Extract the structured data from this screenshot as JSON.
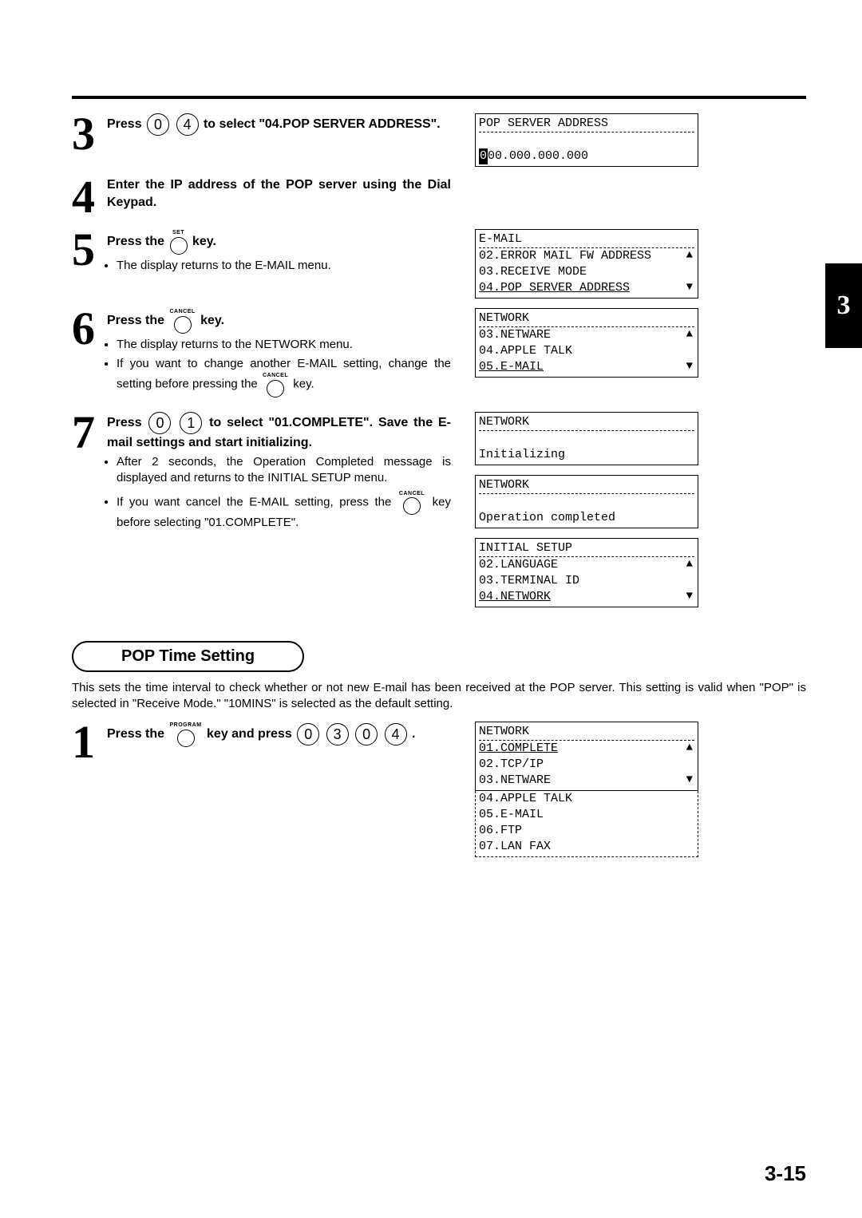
{
  "chapter_tab": "3",
  "page_number": "3-15",
  "key_labels": {
    "set": "SET",
    "cancel": "CANCEL",
    "program": "PROGRAM"
  },
  "keys": {
    "zero": "0",
    "one": "1",
    "three": "3",
    "four": "4"
  },
  "steps": [
    {
      "num": "3",
      "bold_a": "Press",
      "bold_b": "to select \"04.POP SERVER ADDRESS\"."
    },
    {
      "num": "4",
      "bold": "Enter the IP address of the POP server using the Dial Keypad."
    },
    {
      "num": "5",
      "bold_a": "Press the",
      "bold_b": "key.",
      "bullet1": "The display returns to the E-MAIL menu."
    },
    {
      "num": "6",
      "bold_a": "Press the",
      "bold_b": "key.",
      "bullet1": "The display returns to the NETWORK menu.",
      "bullet2_a": "If you want to change another E-MAIL setting, change the setting before pressing the",
      "bullet2_b": "key."
    },
    {
      "num": "7",
      "bold_a": "Press",
      "bold_b": "to select \"01.COMPLETE\". Save the E-mail settings and start initializing.",
      "bullet1": "After 2 seconds, the Operation Completed message is displayed and returns to the INITIAL SETUP menu.",
      "bullet2_a": "If you want cancel the E-MAIL setting, press the",
      "bullet2_b": "key before selecting \"01.COMPLETE\"."
    }
  ],
  "lcd_pop": {
    "title": "POP SERVER ADDRESS",
    "ip_first": "0",
    "ip_rest": "00.000.000.000"
  },
  "lcd_email": {
    "title": "E-MAIL",
    "r1": "02.ERROR MAIL FW ADDRESS",
    "r2": "03.RECEIVE MODE",
    "r3": "04.POP SERVER ADDRESS"
  },
  "lcd_net1": {
    "title": "NETWORK",
    "r1": "03.NETWARE",
    "r2": "04.APPLE TALK",
    "r3": "05.E-MAIL"
  },
  "lcd_init": {
    "title": "NETWORK",
    "r3": "Initializing"
  },
  "lcd_comp": {
    "title": "NETWORK",
    "r3": "Operation completed"
  },
  "lcd_setup": {
    "title": "INITIAL SETUP",
    "r1": "02.LANGUAGE",
    "r2": "03.TERMINAL ID",
    "r3": "04.NETWORK"
  },
  "section2": {
    "heading": "POP Time Setting",
    "intro": "This sets the time interval to check whether or not new E-mail has been received at the POP server. This setting is valid when \"POP\" is selected in  \"Receive Mode.\"  \"10MINS\" is selected as the default setting.",
    "step1": {
      "num": "1",
      "bold_a": "Press the",
      "bold_b": "key and press",
      "bold_c": "."
    }
  },
  "lcd_net2": {
    "title": "NETWORK",
    "r1": "01.COMPLETE",
    "r2": "02.TCP/IP",
    "r3": "03.NETWARE"
  },
  "lcd_net2_ext": {
    "r4": "04.APPLE TALK",
    "r5": "05.E-MAIL",
    "r6": "06.FTP",
    "r7": "07.LAN FAX"
  }
}
